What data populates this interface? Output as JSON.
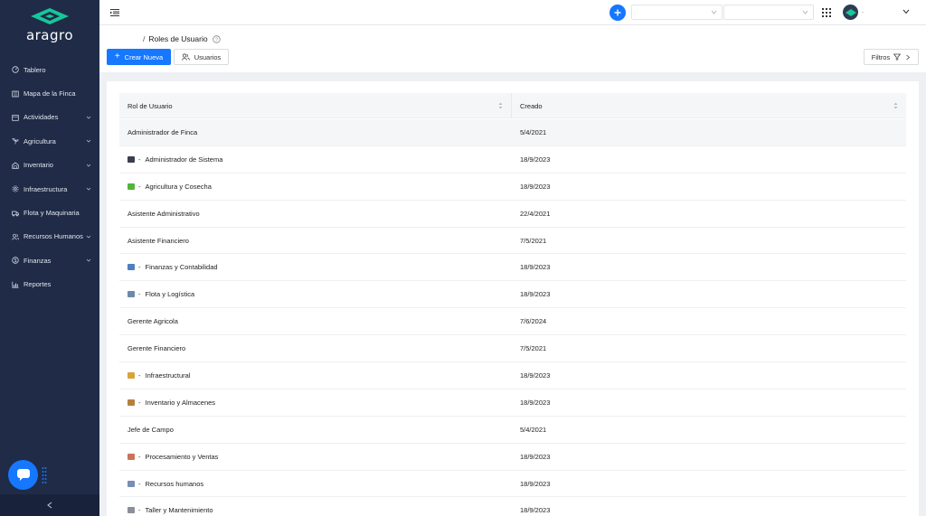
{
  "app": {
    "brand": "aragro",
    "brand_color": "#16c79a"
  },
  "sidebar": {
    "items": [
      {
        "label": "Tablero",
        "icon": "dashboard-icon",
        "has_children": false
      },
      {
        "label": "Mapa de la Finca",
        "icon": "map-icon",
        "has_children": false
      },
      {
        "label": "Actividades",
        "icon": "calendar-icon",
        "has_children": true
      },
      {
        "label": "Agricultura",
        "icon": "sprout-icon",
        "has_children": true
      },
      {
        "label": "Inventario",
        "icon": "warehouse-icon",
        "has_children": true
      },
      {
        "label": "Infraestructura",
        "icon": "gear-icon",
        "has_children": true
      },
      {
        "label": "Flota y Maquinaria",
        "icon": "truck-icon",
        "has_children": false
      },
      {
        "label": "Recursos Humanos",
        "icon": "users-icon",
        "has_children": true
      },
      {
        "label": "Finanzas",
        "icon": "dollar-icon",
        "has_children": true
      },
      {
        "label": "Reportes",
        "icon": "chart-icon",
        "has_children": false
      }
    ]
  },
  "header": {
    "add_icon": "plus-icon",
    "select_1_value": "",
    "select_2_value": "",
    "user_name": "."
  },
  "page": {
    "breadcrumb_sep": "/",
    "title": "Roles de Usuario",
    "primary_button": "Crear Nueva",
    "users_button": "Usuarios",
    "filter_button": "Filtros"
  },
  "table": {
    "columns": [
      "Rol de Usuario",
      "Creado"
    ],
    "rows": [
      {
        "name": "Administrador de Finca",
        "created": "5/4/2021",
        "emoji": "",
        "emoji_color": ""
      },
      {
        "name": "Administrador de Sistema",
        "created": "18/9/2023",
        "emoji": "computer-emoji",
        "emoji_color": "#3a3f4a"
      },
      {
        "name": "Agricultura y Cosecha",
        "created": "18/9/2023",
        "emoji": "seedling-emoji",
        "emoji_color": "#53b33a"
      },
      {
        "name": "Asistente Administrativo",
        "created": "22/4/2021",
        "emoji": "",
        "emoji_color": ""
      },
      {
        "name": "Asistente Financiero",
        "created": "7/5/2021",
        "emoji": "",
        "emoji_color": ""
      },
      {
        "name": "Finanzas y Contabilidad",
        "created": "18/9/2023",
        "emoji": "bar-chart-emoji",
        "emoji_color": "#4f7fbf"
      },
      {
        "name": "Flota y Logística",
        "created": "18/9/2023",
        "emoji": "truck-emoji",
        "emoji_color": "#6b8aa8"
      },
      {
        "name": "Gerente Agricola",
        "created": "7/6/2024",
        "emoji": "",
        "emoji_color": ""
      },
      {
        "name": "Gerente Financiero",
        "created": "7/5/2021",
        "emoji": "",
        "emoji_color": ""
      },
      {
        "name": "Infraestructural",
        "created": "18/9/2023",
        "emoji": "construction-emoji",
        "emoji_color": "#d9a33a"
      },
      {
        "name": "Inventario y Almacenes",
        "created": "18/9/2023",
        "emoji": "package-emoji",
        "emoji_color": "#b5803f"
      },
      {
        "name": "Jefe de Campo",
        "created": "5/4/2021",
        "emoji": "",
        "emoji_color": ""
      },
      {
        "name": "Procesamiento y Ventas",
        "created": "18/9/2023",
        "emoji": "factory-emoji",
        "emoji_color": "#c9735a"
      },
      {
        "name": "Recursos humanos",
        "created": "18/9/2023",
        "emoji": "people-emoji",
        "emoji_color": "#7a8db5"
      },
      {
        "name": "Taller y Mantenimiento",
        "created": "18/9/2023",
        "emoji": "wrench-emoji",
        "emoji_color": "#8a8f99"
      }
    ],
    "highlighted_row": 0
  }
}
